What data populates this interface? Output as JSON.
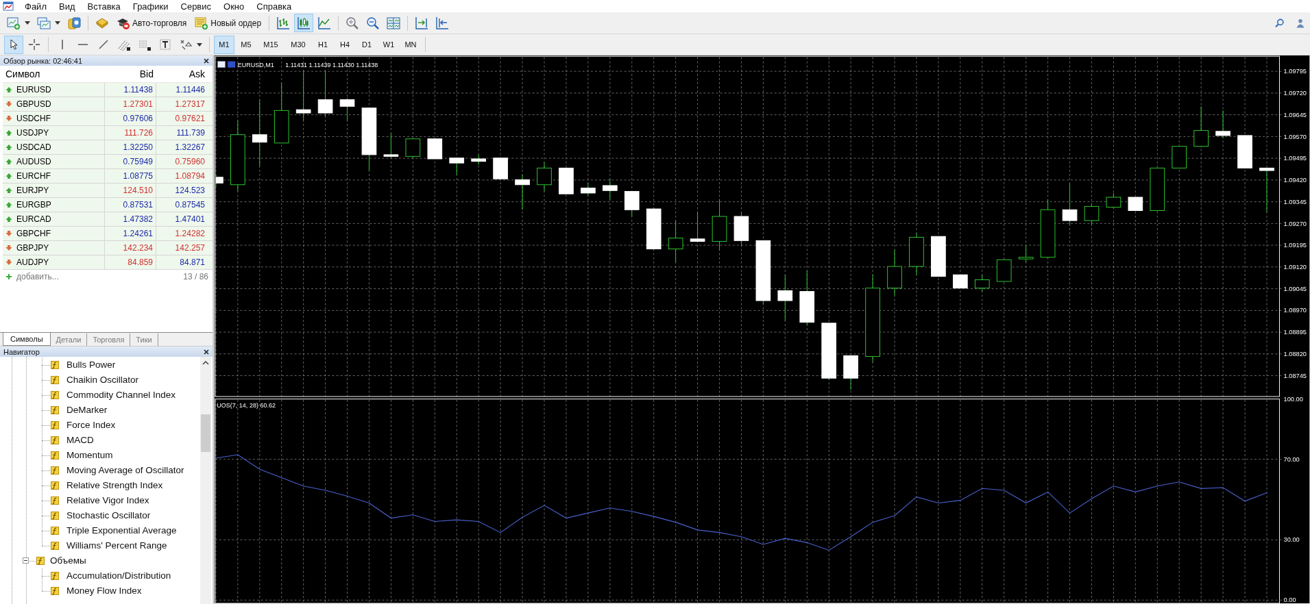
{
  "menu": [
    "Файл",
    "Вид",
    "Вставка",
    "Графики",
    "Сервис",
    "Окно",
    "Справка"
  ],
  "toolbar": {
    "auto_trading": "Авто-торговля",
    "new_order": "Новый ордер",
    "chart_types": [
      {
        "selected": false
      },
      {
        "selected": true
      },
      {
        "selected": false
      }
    ]
  },
  "drawing_tools": [
    {
      "selected": true
    },
    {
      "selected": false
    },
    {
      "selected": false
    },
    {
      "selected": false
    },
    {
      "selected": false
    },
    {
      "selected": false
    },
    {
      "selected": false
    },
    {
      "selected": false
    },
    {
      "selected": false
    }
  ],
  "timeframes": [
    {
      "label": "M1",
      "selected": true
    },
    {
      "label": "M5",
      "selected": false
    },
    {
      "label": "M15",
      "selected": false
    },
    {
      "label": "M30",
      "selected": false
    },
    {
      "label": "H1",
      "selected": false
    },
    {
      "label": "H4",
      "selected": false
    },
    {
      "label": "D1",
      "selected": false
    },
    {
      "label": "W1",
      "selected": false
    },
    {
      "label": "MN",
      "selected": false
    }
  ],
  "market_watch": {
    "title": "Обзор рынка: 02:46:41",
    "columns": [
      "Символ",
      "Bid",
      "Ask"
    ],
    "rows": [
      {
        "symbol": "EURUSD",
        "up": true,
        "bid": "1.11438",
        "bid_up": true,
        "ask": "1.11446",
        "ask_up": true
      },
      {
        "symbol": "GBPUSD",
        "up": false,
        "bid": "1.27301",
        "bid_up": false,
        "ask": "1.27317",
        "ask_up": false
      },
      {
        "symbol": "USDCHF",
        "up": false,
        "bid": "0.97606",
        "bid_up": true,
        "ask": "0.97621",
        "ask_up": false
      },
      {
        "symbol": "USDJPY",
        "up": true,
        "bid": "111.726",
        "bid_up": false,
        "ask": "111.739",
        "ask_up": true
      },
      {
        "symbol": "USDCAD",
        "up": true,
        "bid": "1.32250",
        "bid_up": true,
        "ask": "1.32267",
        "ask_up": true
      },
      {
        "symbol": "AUDUSD",
        "up": true,
        "bid": "0.75949",
        "bid_up": true,
        "ask": "0.75960",
        "ask_up": false
      },
      {
        "symbol": "EURCHF",
        "up": true,
        "bid": "1.08775",
        "bid_up": true,
        "ask": "1.08794",
        "ask_up": false
      },
      {
        "symbol": "EURJPY",
        "up": true,
        "bid": "124.510",
        "bid_up": false,
        "ask": "124.523",
        "ask_up": true
      },
      {
        "symbol": "EURGBP",
        "up": true,
        "bid": "0.87531",
        "bid_up": true,
        "ask": "0.87545",
        "ask_up": true
      },
      {
        "symbol": "EURCAD",
        "up": true,
        "bid": "1.47382",
        "bid_up": true,
        "ask": "1.47401",
        "ask_up": true
      },
      {
        "symbol": "GBPCHF",
        "up": false,
        "bid": "1.24261",
        "bid_up": true,
        "ask": "1.24282",
        "ask_up": false
      },
      {
        "symbol": "GBPJPY",
        "up": false,
        "bid": "142.234",
        "bid_up": false,
        "ask": "142.257",
        "ask_up": false
      },
      {
        "symbol": "AUDJPY",
        "up": false,
        "bid": "84.859",
        "bid_up": false,
        "ask": "84.871",
        "ask_up": true
      }
    ],
    "add_label": "добавить...",
    "count": "13 / 86",
    "tabs": [
      {
        "label": "Символы",
        "selected": true
      },
      {
        "label": "Детали",
        "selected": false
      },
      {
        "label": "Торговля",
        "selected": false
      },
      {
        "label": "Тики",
        "selected": false
      }
    ]
  },
  "navigator": {
    "title": "Навигатор",
    "tree": [
      {
        "children": [
          {
            "label": "Bulls Power"
          },
          {
            "label": "Chaikin Oscillator"
          },
          {
            "label": "Commodity Channel Index"
          },
          {
            "label": "DeMarker"
          },
          {
            "label": "Force Index"
          },
          {
            "label": "MACD"
          },
          {
            "label": "Momentum"
          },
          {
            "label": "Moving Average of Oscillator"
          },
          {
            "label": "Relative Strength Index"
          },
          {
            "label": "Relative Vigor Index"
          },
          {
            "label": "Stochastic Oscillator"
          },
          {
            "label": "Triple Exponential Average"
          },
          {
            "label": "Williams' Percent Range"
          }
        ]
      },
      {
        "label": "Объемы",
        "expanded": true,
        "children": [
          {
            "label": "Accumulation/Distribution"
          },
          {
            "label": "Money Flow Index"
          }
        ]
      }
    ]
  },
  "chart": {
    "title": "EURUSD,M1",
    "ohlc": "1.11431 1.11439 1.11430 1.11438",
    "price_labels": [
      "1.09795",
      "1.09720",
      "1.09645",
      "1.09570",
      "1.09495",
      "1.09420",
      "1.09345",
      "1.09270",
      "1.09195",
      "1.09120",
      "1.09045",
      "1.08970",
      "1.08895",
      "1.08820",
      "1.08745"
    ]
  },
  "indicator": {
    "label": "UOS(7, 14, 28) 60.62",
    "chart_data": {
      "type": "line",
      "ylim": [
        -1.6,
        100
      ],
      "grid": true,
      "yticks": [
        {
          "value": 100,
          "label": "100.00"
        },
        {
          "value": 70,
          "label": "70.00"
        },
        {
          "value": 30,
          "label": "30.00"
        },
        {
          "value": 0,
          "label": "0.00"
        }
      ],
      "series": [
        {
          "color": "#4a62d0",
          "values": [
            70.6,
            72.3,
            65.1,
            60.9,
            56.7,
            54.6,
            51.7,
            48.3,
            40.8,
            42.4,
            39.1,
            39.9,
            39.1,
            33.6,
            41.2,
            47.1,
            40.8,
            43.3,
            45.8,
            44.1,
            41.6,
            38.7,
            34.9,
            33.6,
            31.5,
            27.7,
            30.7,
            28.6,
            24.8,
            31.5,
            38.7,
            42.0,
            51.3,
            48.3,
            49.6,
            55.5,
            54.6,
            48.3,
            53.8,
            43.3,
            50.4,
            56.7,
            53.8,
            56.7,
            58.8,
            55.5,
            55.9,
            49.2,
            53.4
          ]
        }
      ]
    }
  }
}
